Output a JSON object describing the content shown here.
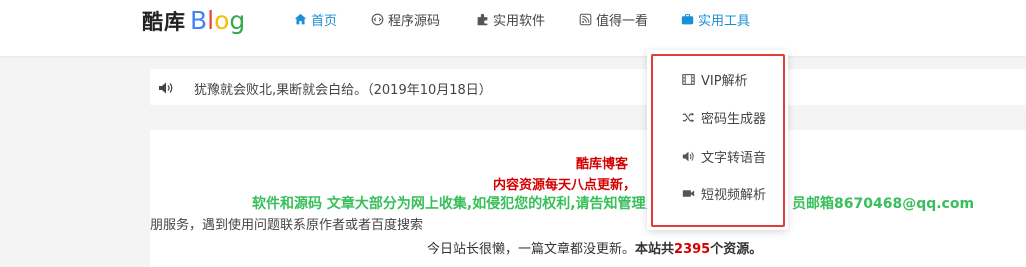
{
  "logo": {
    "cn": "酷库",
    "en": "Blog"
  },
  "nav": {
    "items": [
      {
        "label": "首页",
        "icon": "home-icon",
        "active": true
      },
      {
        "label": "程序源码",
        "icon": "code-icon"
      },
      {
        "label": "实用软件",
        "icon": "puzzle-icon"
      },
      {
        "label": "值得一看",
        "icon": "rss-icon"
      },
      {
        "label": "实用工具",
        "icon": "briefcase-icon",
        "active": true
      }
    ]
  },
  "notice": {
    "icon": "speaker-icon",
    "text": "犹豫就会败北,果断就会白给。（2019年10月18日）"
  },
  "content": {
    "title": "酷库博客",
    "update_line": "内容资源每天八点更新，",
    "update_cut": "!",
    "source_line": "软件和源码 文章大部分为网上收集,如侵犯您的权利,请告知管理员",
    "source_cut": "员邮箱8670468@qq.com",
    "service_line": "朋服务，遇到使用问题联系原作者或者百度搜索",
    "stats": {
      "prefix": "今日站长很懒，一篇文章都没更新。",
      "site_label": "本站共",
      "count": "2395",
      "suffix": "个资源。"
    }
  },
  "dropdown": {
    "items": [
      {
        "label": "VIP解析",
        "icon": "film-icon"
      },
      {
        "label": "密码生成器",
        "icon": "shuffle-icon"
      },
      {
        "label": "文字转语音",
        "icon": "volume-icon"
      },
      {
        "label": "短视频解析",
        "icon": "video-camera-icon"
      }
    ]
  },
  "colors": {
    "accent": "#1a8fd8",
    "red": "#d40000",
    "green": "#37bf5a",
    "highlight_border": "#e23b3b"
  }
}
